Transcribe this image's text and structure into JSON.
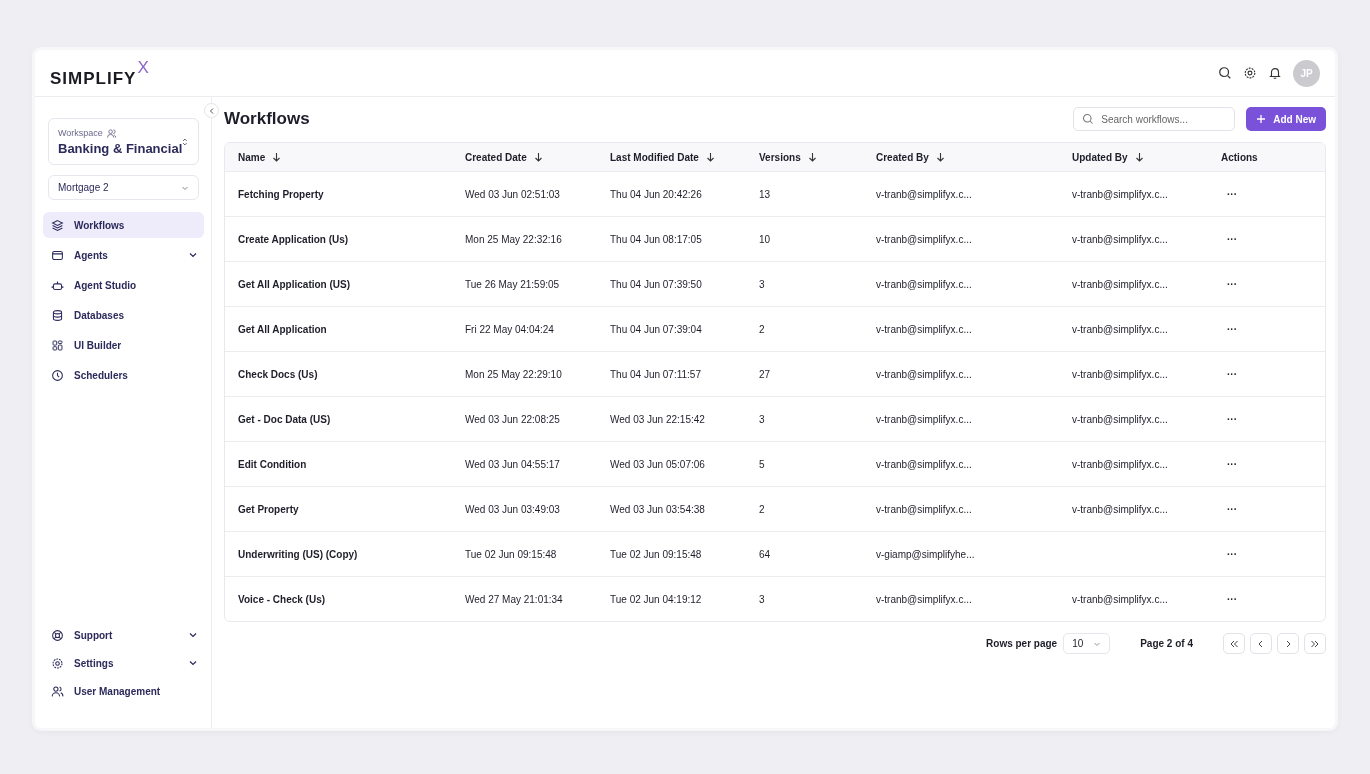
{
  "logo": {
    "text": "SIMPLIFY",
    "mark": "X"
  },
  "header": {
    "avatar": "JP"
  },
  "sidebar": {
    "workspace": {
      "label": "Workspace",
      "name": "Banking & Financial"
    },
    "project": "Mortgage 2",
    "items": [
      {
        "label": "Workflows",
        "selected": true
      },
      {
        "label": "Agents",
        "selected": false,
        "expanded": false
      },
      {
        "label": "Agent Studio",
        "selected": false
      },
      {
        "label": "Databases",
        "selected": false
      },
      {
        "label": "UI Builder",
        "selected": false
      },
      {
        "label": "Schedulers",
        "selected": false
      }
    ],
    "footer_items": [
      {
        "label": "Support",
        "expanded": false
      },
      {
        "label": "Settings",
        "expanded": false
      },
      {
        "label": "User Management"
      }
    ]
  },
  "page": {
    "title": "Workflows",
    "search": {
      "placeholder": "Search workflows..."
    },
    "add_button": "Add New"
  },
  "table": {
    "columns": [
      {
        "label": "Name",
        "sortable": true
      },
      {
        "label": "Created Date",
        "sortable": true
      },
      {
        "label": "Last Modified Date",
        "sortable": true
      },
      {
        "label": "Versions",
        "sortable": true
      },
      {
        "label": "Created By",
        "sortable": true
      },
      {
        "label": "Updated By",
        "sortable": true
      },
      {
        "label": "Actions",
        "sortable": false
      }
    ],
    "rows": [
      {
        "name": "Fetching Property",
        "created": "Wed 03 Jun 02:51:03",
        "modified": "Thu 04 Jun 20:42:26",
        "versions": "13",
        "created_by": "v-tranb@simplifyx.c...",
        "updated_by": "v-tranb@simplifyx.c...",
        "actions": "···"
      },
      {
        "name": "Create Application (Us)",
        "created": "Mon 25 May 22:32:16",
        "modified": "Thu 04 Jun 08:17:05",
        "versions": "10",
        "created_by": "v-tranb@simplifyx.c...",
        "updated_by": "v-tranb@simplifyx.c...",
        "actions": "···"
      },
      {
        "name": "Get All Application (US)",
        "created": "Tue 26 May 21:59:05",
        "modified": "Thu 04 Jun 07:39:50",
        "versions": "3",
        "created_by": "v-tranb@simplifyx.c...",
        "updated_by": "v-tranb@simplifyx.c...",
        "actions": "···"
      },
      {
        "name": "Get All Application",
        "created": "Fri 22 May 04:04:24",
        "modified": "Thu 04 Jun 07:39:04",
        "versions": "2",
        "created_by": "v-tranb@simplifyx.c...",
        "updated_by": "v-tranb@simplifyx.c...",
        "actions": "···"
      },
      {
        "name": "Check Docs (Us)",
        "created": "Mon 25 May 22:29:10",
        "modified": "Thu 04 Jun 07:11:57",
        "versions": "27",
        "created_by": "v-tranb@simplifyx.c...",
        "updated_by": "v-tranb@simplifyx.c...",
        "actions": "···"
      },
      {
        "name": "Get - Doc Data (US)",
        "created": "Wed 03 Jun 22:08:25",
        "modified": "Wed 03 Jun 22:15:42",
        "versions": "3",
        "created_by": "v-tranb@simplifyx.c...",
        "updated_by": "v-tranb@simplifyx.c...",
        "actions": "···"
      },
      {
        "name": "Edit Condition",
        "created": "Wed 03 Jun 04:55:17",
        "modified": "Wed 03 Jun 05:07:06",
        "versions": "5",
        "created_by": "v-tranb@simplifyx.c...",
        "updated_by": "v-tranb@simplifyx.c...",
        "actions": "···"
      },
      {
        "name": "Get Property",
        "created": "Wed 03 Jun 03:49:03",
        "modified": "Wed 03 Jun 03:54:38",
        "versions": "2",
        "created_by": "v-tranb@simplifyx.c...",
        "updated_by": "v-tranb@simplifyx.c...",
        "actions": "···"
      },
      {
        "name": "Underwriting (US) (Copy)",
        "created": "Tue 02 Jun 09:15:48",
        "modified": "Tue 02 Jun 09:15:48",
        "versions": "64",
        "created_by": "v-giamp@simplifyhe...",
        "actions": "···"
      },
      {
        "name": "Voice - Check (Us)",
        "created": "Wed 27 May 21:01:34",
        "modified": "Tue 02 Jun 04:19:12",
        "versions": "3",
        "created_by": "v-tranb@simplifyx.c...",
        "updated_by": "v-tranb@simplifyx.c...",
        "actions": "···"
      }
    ]
  },
  "pagination": {
    "rows_label": "Rows per page",
    "rows_value": "10",
    "page_info": "Page 2 of 4"
  }
}
